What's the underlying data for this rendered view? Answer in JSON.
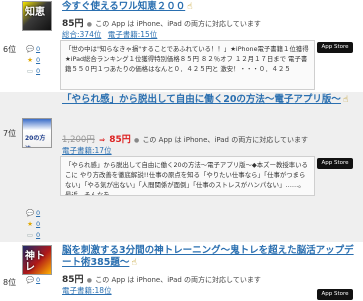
{
  "entries": [
    {
      "rank": "6位",
      "icon_label": "知恵",
      "title": "今すぐ使えるワル知恵２００",
      "price": "85円",
      "availability": "この App は iPhone、iPad の両方に対応しています",
      "genre": "総合:374位",
      "genre_link": "電子書籍:15位",
      "description": "「世の中は\"知らなきゃ損\"することであふれている！！」★iPhone電子書籍１位獲得★iPad総合ランキング１位獲得特別価格８５円 ８２％オフ １２月１７日まで 電子書籍５５０円１つあたりの価格はなんと０．４２５円と 激安！・・・０．４２５",
      "store_badge": "App Store",
      "stats": {
        "comments": "0",
        "stars": "0",
        "tags": "0"
      }
    },
    {
      "rank": "7位",
      "icon_label": "20の方法",
      "title": "「やられ感」から脱出して自由に働く20の方法～電子アプリ版～",
      "old_price": "1,200円",
      "arrow": "⇒",
      "price": "85円",
      "availability": "この App は iPhone、iPad の両方に対応しています",
      "genre_link": "電子書籍:17位",
      "description": "「やられ感」から脱出して自由に働く20の方法～電子アプリ版～◆本ズー教授率いるこに やり方改善を徹底解説!!仕事の原点を知る「やりたい仕事なら」「仕事がつまらない」「やる気が出ない」「人間関係が面倒」「仕事のストレスがハンパない」……。最近、そんなを……",
      "store_badge": "App Store",
      "stats": {
        "comments": "0",
        "stars": "0",
        "tags": "0"
      }
    },
    {
      "rank": "8位",
      "icon_label": "神トレ",
      "title": "脳を刺激する3分間の神トレーニング～鬼トレを超えた脳活アップデート術385題～",
      "price": "85円",
      "availability": "この App は iPhone、iPad の両方に対応しています",
      "genre_link": "電子書籍:18位",
      "store_badge": "App Store",
      "stats": {
        "comments": "0"
      }
    }
  ],
  "icons": {
    "hand": "hand-pointer-icon",
    "apple": "apple-icon",
    "comment": "comment-bubble-icon",
    "star": "star-icon",
    "tag": "tag-icon"
  }
}
